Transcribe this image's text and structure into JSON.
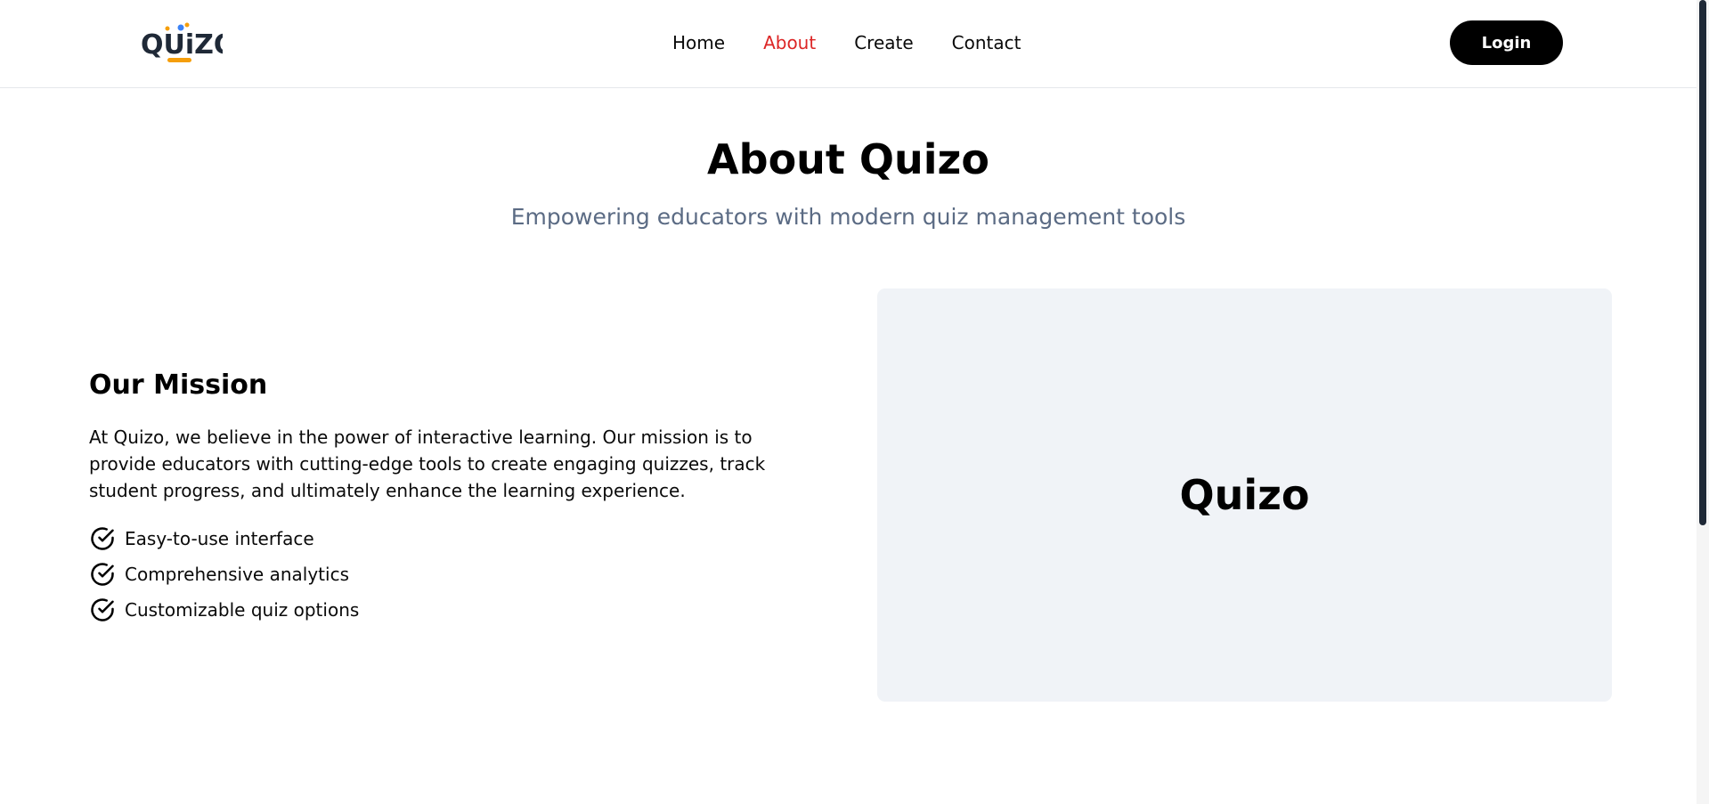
{
  "header": {
    "logo_text": "QUIZO",
    "nav": [
      {
        "label": "Home"
      },
      {
        "label": "About"
      },
      {
        "label": "Create"
      },
      {
        "label": "Contact"
      }
    ],
    "login_label": "Login"
  },
  "hero": {
    "title": "About Quizo",
    "subtitle": "Empowering educators with modern quiz management tools"
  },
  "mission": {
    "title": "Our Mission",
    "text": "At Quizo, we believe in the power of interactive learning. Our mission is to provide educators with cutting-edge tools to create engaging quizzes, track student progress, and ultimately enhance the learning experience.",
    "features": [
      {
        "label": "Easy-to-use interface",
        "icon": "check-circle-icon"
      },
      {
        "label": "Comprehensive analytics",
        "icon": "check-circle-icon"
      },
      {
        "label": "Customizable quiz options",
        "icon": "check-circle-icon"
      }
    ]
  },
  "card": {
    "title": "Quizo"
  },
  "colors": {
    "active_nav": "#dc2626",
    "subtitle": "#5b6b84",
    "card_bg": "#f0f3f7",
    "logo_orange": "#f59e0b",
    "logo_blue": "#3b82f6",
    "logo_dark": "#1f2937"
  }
}
